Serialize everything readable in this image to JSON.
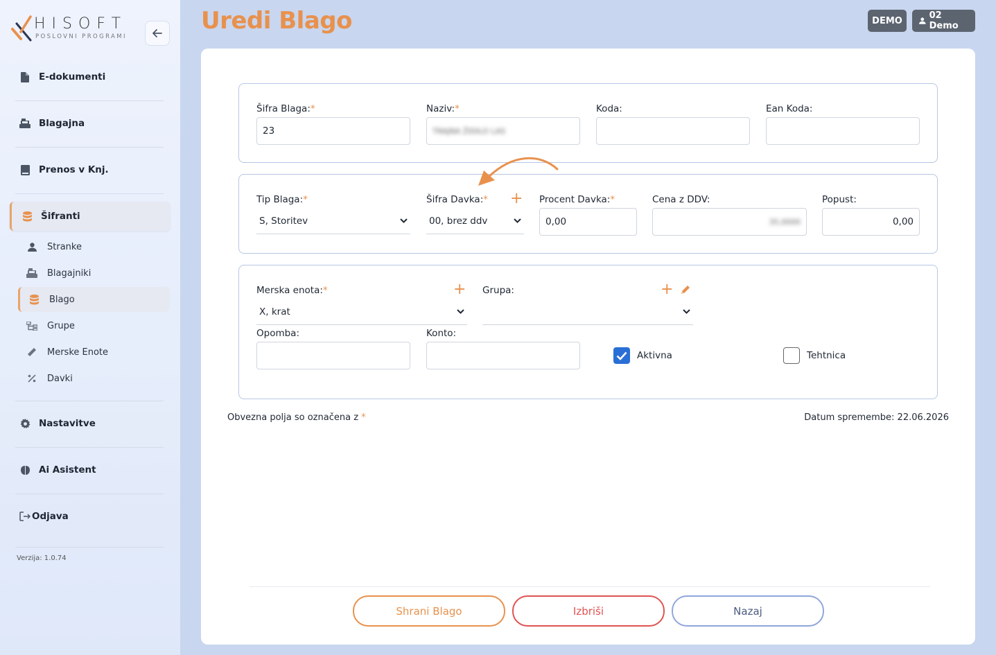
{
  "brand": {
    "name": "HISOFT",
    "tagline": "POSLOVNI PROGRAMI",
    "accent_color": "#e8914d"
  },
  "sidebar": {
    "collapse_icon": "arrow-left-icon",
    "items": [
      {
        "label": "E-dokumenti",
        "icon": "file-icon"
      },
      {
        "label": "Blagajna",
        "icon": "cash-register-icon"
      },
      {
        "label": "Prenos v Knj.",
        "icon": "book-icon"
      },
      {
        "label": "Šifranti",
        "icon": "database-icon"
      },
      {
        "label": "Nastavitve",
        "icon": "gear-icon"
      },
      {
        "label": "Ai Asistent",
        "icon": "brain-icon"
      },
      {
        "label": "Odjava",
        "icon": "logout-icon"
      }
    ],
    "sub_items": [
      {
        "label": "Stranke",
        "icon": "user-icon"
      },
      {
        "label": "Blagajniki",
        "icon": "cash-register-icon"
      },
      {
        "label": "Blago",
        "icon": "database-icon"
      },
      {
        "label": "Grupe",
        "icon": "sitemap-icon"
      },
      {
        "label": "Merske Enote",
        "icon": "ruler-icon"
      },
      {
        "label": "Davki",
        "icon": "percent-icon"
      }
    ],
    "version": "Verzija: 1.0.74"
  },
  "header": {
    "title": "Uredi Blago",
    "env_badge": "DEMO",
    "user_badge": "02 Demo"
  },
  "form": {
    "sifra_blaga": {
      "label": "Šifra Blaga:",
      "value": "23"
    },
    "naziv": {
      "label": "Naziv:",
      "value": "TRAJNA ŽIDILO LAS"
    },
    "koda": {
      "label": "Koda:",
      "value": ""
    },
    "ean_koda": {
      "label": "Ean Koda:",
      "value": ""
    },
    "tip_blaga": {
      "label": "Tip Blaga:",
      "value": "S, Storitev"
    },
    "sifra_davka": {
      "label": "Šifra Davka:",
      "value": "00, brez ddv"
    },
    "procent_davka": {
      "label": "Procent Davka:",
      "value": "0,00"
    },
    "cena_z_ddv": {
      "label": "Cena z DDV:",
      "value": "35,0000"
    },
    "popust": {
      "label": "Popust:",
      "value": "0,00"
    },
    "merska_enota": {
      "label": "Merska enota:",
      "value": "X, krat"
    },
    "grupa": {
      "label": "Grupa:",
      "value": ""
    },
    "opomba": {
      "label": "Opomba:",
      "value": ""
    },
    "konto": {
      "label": "Konto:",
      "value": ""
    },
    "aktivna": {
      "label": "Aktivna",
      "checked": true
    },
    "tehtnica": {
      "label": "Tehtnica",
      "checked": false
    },
    "required_mark": "*"
  },
  "footer": {
    "required_note": "Obvezna polja so označena z",
    "date_label": "Datum spremembe: 22.06.2026"
  },
  "buttons": {
    "save": "Shrani Blago",
    "delete": "Izbriši",
    "back": "Nazaj"
  },
  "colors": {
    "save": "#e8914d",
    "delete": "#e05252",
    "back": "#8fa6da",
    "checkbox": "#2a6fd6"
  }
}
